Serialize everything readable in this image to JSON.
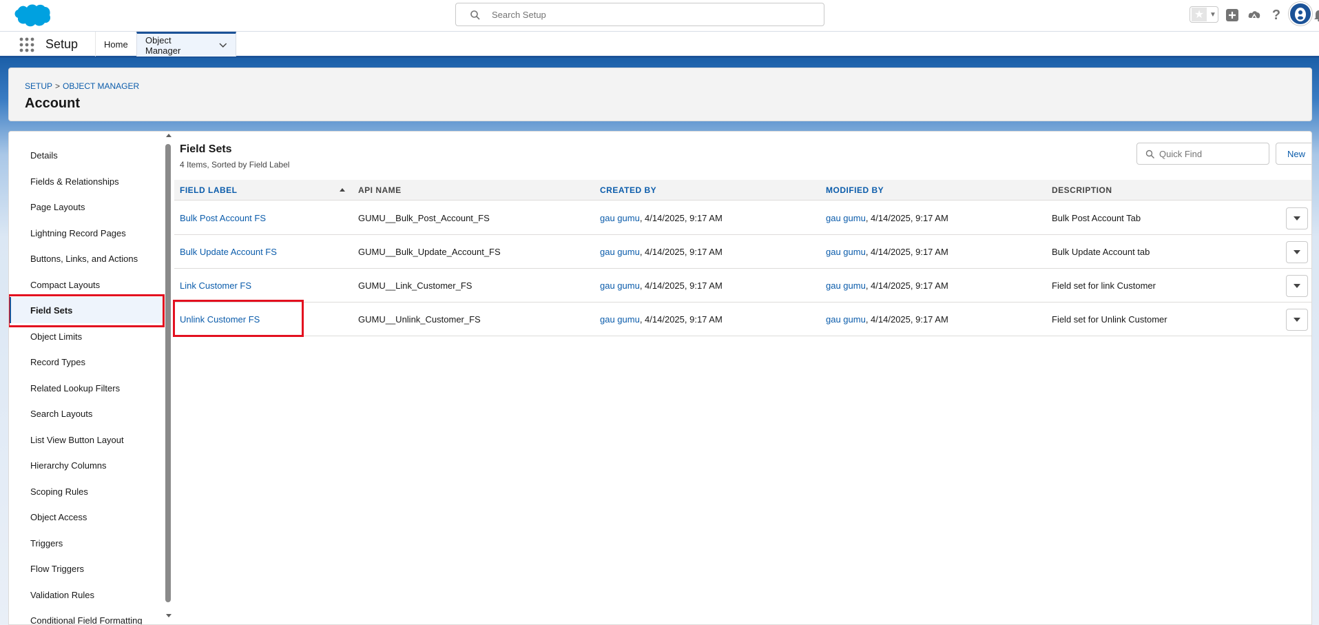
{
  "global_header": {
    "search_placeholder": "Search Setup",
    "icons": [
      "favorites-star-icon",
      "add-icon",
      "trailhead-icon",
      "help-icon",
      "setup-gear-icon",
      "notifications-bell-icon",
      "user-avatar-icon"
    ]
  },
  "context_bar": {
    "app_name": "Setup",
    "tabs": [
      {
        "label": "Home"
      },
      {
        "label": "Object Manager"
      }
    ]
  },
  "page_header": {
    "breadcrumb": [
      "SETUP",
      "OBJECT MANAGER"
    ],
    "breadcrumb_sep": ">",
    "title": "Account"
  },
  "sidebar": {
    "items": [
      {
        "label": "Details"
      },
      {
        "label": "Fields & Relationships"
      },
      {
        "label": "Page Layouts"
      },
      {
        "label": "Lightning Record Pages"
      },
      {
        "label": "Buttons, Links, and Actions"
      },
      {
        "label": "Compact Layouts"
      },
      {
        "label": "Field Sets"
      },
      {
        "label": "Object Limits"
      },
      {
        "label": "Record Types"
      },
      {
        "label": "Related Lookup Filters"
      },
      {
        "label": "Search Layouts"
      },
      {
        "label": "List View Button Layout"
      },
      {
        "label": "Hierarchy Columns"
      },
      {
        "label": "Scoping Rules"
      },
      {
        "label": "Object Access"
      },
      {
        "label": "Triggers"
      },
      {
        "label": "Flow Triggers"
      },
      {
        "label": "Validation Rules"
      },
      {
        "label": "Conditional Field Formatting"
      }
    ],
    "active_index": 6
  },
  "content": {
    "title": "Field Sets",
    "subtitle": "4 Items, Sorted by Field Label",
    "quick_find_placeholder": "Quick Find",
    "new_label": "New",
    "columns": {
      "field_label": "FIELD LABEL",
      "api_name": "API NAME",
      "created_by": "CREATED BY",
      "modified_by": "MODIFIED BY",
      "description": "DESCRIPTION"
    },
    "rows": [
      {
        "field_label": "Bulk Post Account FS",
        "api_name": "GUMU__Bulk_Post_Account_FS",
        "created_user": "gau gumu",
        "created_date": ", 4/14/2025, 9:17 AM",
        "modified_user": "gau gumu",
        "modified_date": ", 4/14/2025, 9:17 AM",
        "description": "Bulk Post Account Tab"
      },
      {
        "field_label": "Bulk Update Account FS",
        "api_name": "GUMU__Bulk_Update_Account_FS",
        "created_user": "gau gumu",
        "created_date": ", 4/14/2025, 9:17 AM",
        "modified_user": "gau gumu",
        "modified_date": ", 4/14/2025, 9:17 AM",
        "description": "Bulk Update Account tab"
      },
      {
        "field_label": "Link Customer FS",
        "api_name": "GUMU__Link_Customer_FS",
        "created_user": "gau gumu",
        "created_date": ", 4/14/2025, 9:17 AM",
        "modified_user": "gau gumu",
        "modified_date": ", 4/14/2025, 9:17 AM",
        "description": "Field set for link Customer"
      },
      {
        "field_label": "Unlink Customer FS",
        "api_name": "GUMU__Unlink_Customer_FS",
        "created_user": "gau gumu",
        "created_date": ", 4/14/2025, 9:17 AM",
        "modified_user": "gau gumu",
        "modified_date": ", 4/14/2025, 9:17 AM",
        "description": "Field set for Unlink Customer"
      }
    ]
  },
  "colors": {
    "brand": "#1b5297",
    "link": "#0b5cab",
    "highlight_box": "#e3101f"
  }
}
